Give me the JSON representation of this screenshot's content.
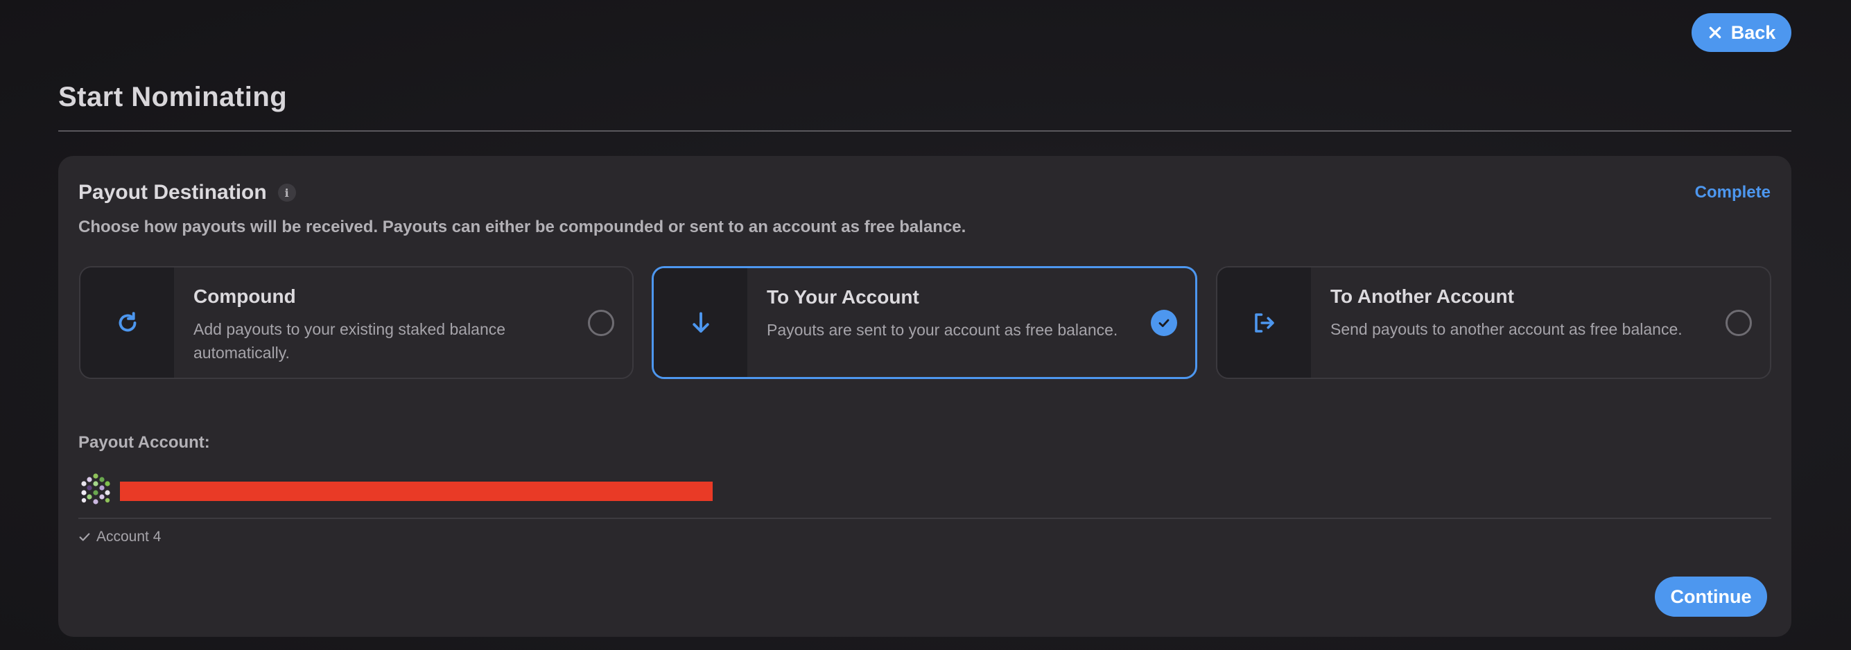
{
  "header": {
    "back_label": "Back",
    "page_title": "Start Nominating"
  },
  "payout_destination": {
    "heading": "Payout Destination",
    "info_icon": "i",
    "status_label": "Complete",
    "subtitle": "Choose how payouts will be received. Payouts can either be compounded or sent to an account as free balance.",
    "options": [
      {
        "title": "Compound",
        "description": "Add payouts to your existing staked balance automatically.",
        "icon": "refresh-icon",
        "selected": false
      },
      {
        "title": "To Your Account",
        "description": "Payouts are sent to your account as free balance.",
        "icon": "arrow-down-icon",
        "selected": true
      },
      {
        "title": "To Another Account",
        "description": "Send payouts to another account as free balance.",
        "icon": "sign-out-icon",
        "selected": false
      }
    ]
  },
  "payout_account": {
    "label": "Payout Account:",
    "account_name": "Account 4"
  },
  "footer": {
    "continue_label": "Continue"
  },
  "colors": {
    "accent": "#4d97ef",
    "redaction": "#e93a26",
    "panel": "#2a282c"
  }
}
